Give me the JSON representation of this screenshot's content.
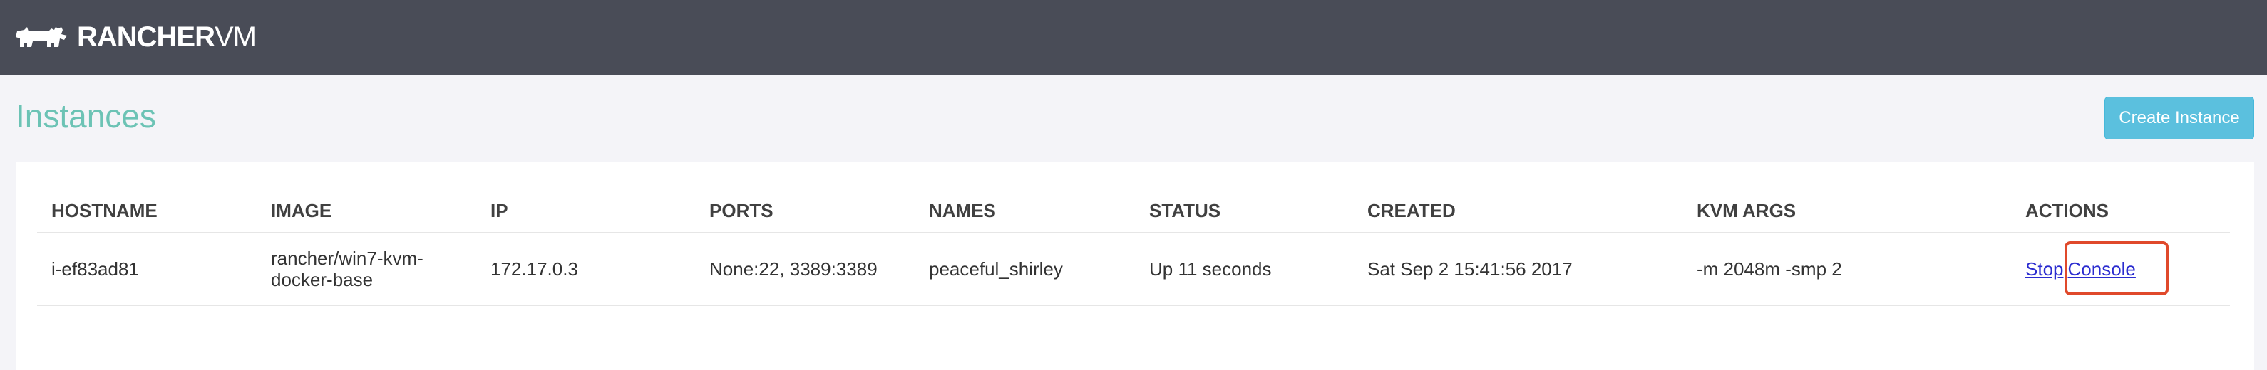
{
  "app": {
    "logo_bold": "RANCHER",
    "logo_light": "VM",
    "logo_icon": "cow-icon"
  },
  "page": {
    "title": "Instances",
    "create_button": "Create Instance"
  },
  "table": {
    "headers": [
      "HOSTNAME",
      "IMAGE",
      "IP",
      "PORTS",
      "NAMES",
      "STATUS",
      "CREATED",
      "KVM ARGS",
      "ACTIONS"
    ],
    "rows": [
      {
        "hostname": "i-ef83ad81",
        "image": "rancher/win7-kvm-docker-base",
        "ip": "172.17.0.3",
        "ports": "None:22, 3389:3389",
        "names": "peaceful_shirley",
        "status": "Up 11 seconds",
        "created": "Sat Sep 2 15:41:56 2017",
        "kvm_args": "-m 2048m -smp 2",
        "actions": {
          "stop": "Stop",
          "console": "Console"
        }
      }
    ]
  },
  "colors": {
    "topbar": "#494c57",
    "title": "#6cc3b5",
    "button": "#5bc0de",
    "highlight": "#e0492b",
    "link": "#2b2ccf"
  }
}
